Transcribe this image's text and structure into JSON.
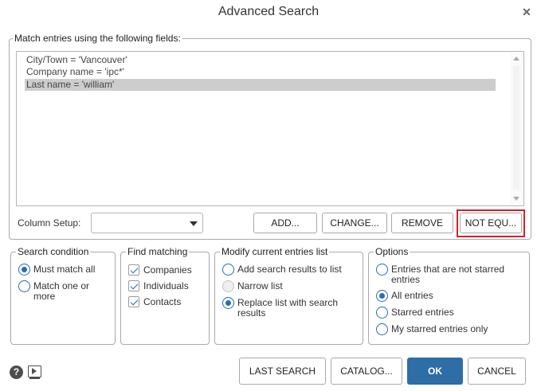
{
  "dialog": {
    "title": "Advanced Search"
  },
  "match": {
    "legend": "Match entries using the following fields:",
    "criteria": [
      {
        "text": "City/Town = 'Vancouver'",
        "selected": false
      },
      {
        "text": "Company name = 'ipc*'",
        "selected": false
      },
      {
        "text": "Last name = 'william'",
        "selected": true
      }
    ],
    "column_setup_label": "Column Setup:",
    "column_setup_value": "",
    "buttons": {
      "add": "ADD...",
      "change": "CHANGE...",
      "remove": "REMOVE",
      "not_equal": "NOT EQU..."
    }
  },
  "search_condition": {
    "legend": "Search condition",
    "options": [
      "Must match all",
      "Match one or more"
    ],
    "selected": 0
  },
  "find_matching": {
    "legend": "Find matching",
    "options": [
      "Companies",
      "Individuals",
      "Contacts"
    ],
    "checked": [
      true,
      true,
      true
    ]
  },
  "modify_list": {
    "legend": "Modify current entries list",
    "options": [
      "Add search results to list",
      "Narrow list",
      "Replace list with search results"
    ],
    "selected": 2,
    "disabled": [
      false,
      true,
      false
    ]
  },
  "options": {
    "legend": "Options",
    "items": [
      "Entries that are not starred entries",
      "All entries",
      "Starred entries",
      "My starred entries only"
    ],
    "selected": 1
  },
  "footer": {
    "last_search": "LAST SEARCH",
    "catalog": "CATALOG...",
    "ok": "OK",
    "cancel": "CANCEL",
    "help_glyph": "?"
  },
  "colors": {
    "accent": "#2e6da6",
    "highlight": "#d6202a",
    "selection": "#cdcdcd"
  },
  "icons": [
    "close-icon",
    "help-icon",
    "video-icon",
    "chevron-down-icon"
  ]
}
